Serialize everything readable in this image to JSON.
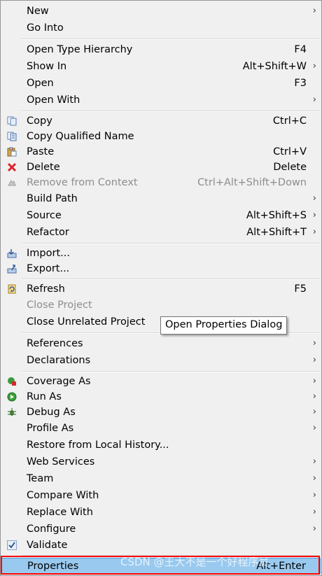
{
  "menu": {
    "items": [
      {
        "label": "New",
        "shortcut": "",
        "arrow": true,
        "icon": "",
        "disabled": false
      },
      {
        "label": "Go Into",
        "shortcut": "",
        "arrow": false,
        "icon": "",
        "disabled": false
      },
      {
        "label": "Open Type Hierarchy",
        "shortcut": "F4",
        "arrow": false,
        "icon": "",
        "disabled": false
      },
      {
        "label": "Show In",
        "shortcut": "Alt+Shift+W",
        "arrow": true,
        "icon": "",
        "disabled": false
      },
      {
        "label": "Open",
        "shortcut": "F3",
        "arrow": false,
        "icon": "",
        "disabled": false
      },
      {
        "label": "Open With",
        "shortcut": "",
        "arrow": true,
        "icon": "",
        "disabled": false
      },
      {
        "label": "Copy",
        "shortcut": "Ctrl+C",
        "arrow": false,
        "icon": "copy-icon",
        "disabled": false
      },
      {
        "label": "Copy Qualified Name",
        "shortcut": "",
        "arrow": false,
        "icon": "copy-qualified-name-icon",
        "disabled": false
      },
      {
        "label": "Paste",
        "shortcut": "Ctrl+V",
        "arrow": false,
        "icon": "paste-icon",
        "disabled": false
      },
      {
        "label": "Delete",
        "shortcut": "Delete",
        "arrow": false,
        "icon": "delete-icon",
        "disabled": false
      },
      {
        "label": "Remove from Context",
        "shortcut": "Ctrl+Alt+Shift+Down",
        "arrow": false,
        "icon": "remove-context-icon",
        "disabled": true
      },
      {
        "label": "Build Path",
        "shortcut": "",
        "arrow": true,
        "icon": "",
        "disabled": false
      },
      {
        "label": "Source",
        "shortcut": "Alt+Shift+S",
        "arrow": true,
        "icon": "",
        "disabled": false
      },
      {
        "label": "Refactor",
        "shortcut": "Alt+Shift+T",
        "arrow": true,
        "icon": "",
        "disabled": false
      },
      {
        "label": "Import...",
        "shortcut": "",
        "arrow": false,
        "icon": "import-icon",
        "disabled": false
      },
      {
        "label": "Export...",
        "shortcut": "",
        "arrow": false,
        "icon": "export-icon",
        "disabled": false
      },
      {
        "label": "Refresh",
        "shortcut": "F5",
        "arrow": false,
        "icon": "refresh-icon",
        "disabled": false
      },
      {
        "label": "Close Project",
        "shortcut": "",
        "arrow": false,
        "icon": "",
        "disabled": true
      },
      {
        "label": "Close Unrelated Project",
        "shortcut": "",
        "arrow": false,
        "icon": "",
        "disabled": false
      },
      {
        "label": "References",
        "shortcut": "",
        "arrow": true,
        "icon": "",
        "disabled": false
      },
      {
        "label": "Declarations",
        "shortcut": "",
        "arrow": true,
        "icon": "",
        "disabled": false
      },
      {
        "label": "Coverage As",
        "shortcut": "",
        "arrow": true,
        "icon": "coverage-icon",
        "disabled": false
      },
      {
        "label": "Run As",
        "shortcut": "",
        "arrow": true,
        "icon": "run-icon",
        "disabled": false
      },
      {
        "label": "Debug As",
        "shortcut": "",
        "arrow": true,
        "icon": "debug-icon",
        "disabled": false
      },
      {
        "label": "Profile As",
        "shortcut": "",
        "arrow": true,
        "icon": "",
        "disabled": false
      },
      {
        "label": "Restore from Local History...",
        "shortcut": "",
        "arrow": false,
        "icon": "",
        "disabled": false
      },
      {
        "label": "Web Services",
        "shortcut": "",
        "arrow": true,
        "icon": "",
        "disabled": false
      },
      {
        "label": "Team",
        "shortcut": "",
        "arrow": true,
        "icon": "",
        "disabled": false
      },
      {
        "label": "Compare With",
        "shortcut": "",
        "arrow": true,
        "icon": "",
        "disabled": false
      },
      {
        "label": "Replace With",
        "shortcut": "",
        "arrow": true,
        "icon": "",
        "disabled": false
      },
      {
        "label": "Configure",
        "shortcut": "",
        "arrow": true,
        "icon": "",
        "disabled": false
      },
      {
        "label": "Validate",
        "shortcut": "",
        "arrow": false,
        "icon": "validate-check-icon",
        "disabled": false
      },
      {
        "label": "Properties",
        "shortcut": "Alt+Enter",
        "arrow": false,
        "icon": "",
        "disabled": false,
        "highlight": true
      }
    ]
  },
  "tooltip": {
    "text": "Open Properties Dialog"
  },
  "watermark": {
    "text": "CSDN @王大不是一个好程序员"
  },
  "colors": {
    "highlight": "#99c9ef",
    "highlight_border": "#4aa0e0",
    "redbox": "#ff0000"
  }
}
